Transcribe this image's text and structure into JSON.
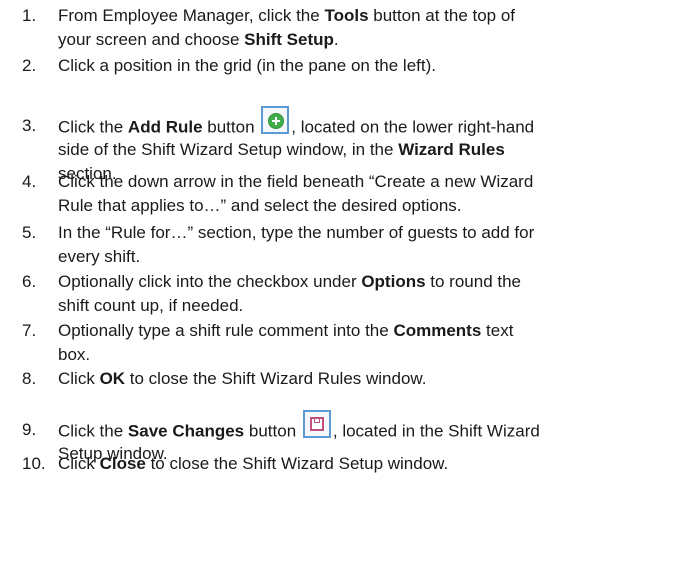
{
  "steps": [
    {
      "num": "1.",
      "lines": [
        [
          {
            "t": "From Employee Manager, click the "
          },
          {
            "t": "Tools",
            "b": true
          },
          {
            "t": " button at the top of"
          }
        ],
        [
          {
            "t": "your screen and choose "
          },
          {
            "t": "Shift Setup",
            "b": true
          },
          {
            "t": "."
          }
        ]
      ]
    },
    {
      "num": "2.",
      "lines": [
        [
          {
            "t": "Click a position in the grid (in the pane on the left)."
          }
        ]
      ]
    },
    {
      "num": "3.",
      "lines": [
        [
          {
            "t": "Click the "
          },
          {
            "t": "Add Rule",
            "b": true
          },
          {
            "t": " button "
          },
          {
            "icon": "add-icon"
          },
          {
            "t": ", located on the lower right-hand"
          }
        ],
        [
          {
            "t": "side of the Shift Wizard Setup window, in the "
          },
          {
            "t": "Wizard Rules",
            "b": true
          }
        ],
        [
          {
            "t": "section."
          }
        ]
      ]
    },
    {
      "num": "4.",
      "lines": [
        [
          {
            "t": "Click the down arrow in the field beneath “Create a new Wizard"
          }
        ],
        [
          {
            "t": "Rule that applies to…” and select the desired options."
          }
        ]
      ]
    },
    {
      "num": "5.",
      "lines": [
        [
          {
            "t": "In the “Rule for…” section, type the number of guests to add for"
          }
        ],
        [
          {
            "t": "every shift."
          }
        ]
      ]
    },
    {
      "num": "6.",
      "lines": [
        [
          {
            "t": "Optionally click into the checkbox under "
          },
          {
            "t": "Options",
            "b": true
          },
          {
            "t": " to round the"
          }
        ],
        [
          {
            "t": "shift count up, if needed."
          }
        ]
      ]
    },
    {
      "num": "7.",
      "lines": [
        [
          {
            "t": "Optionally type a shift rule comment into the "
          },
          {
            "t": "Comments",
            "b": true
          },
          {
            "t": " text"
          }
        ],
        [
          {
            "t": "box."
          }
        ]
      ]
    },
    {
      "num": "8.",
      "lines": [
        [
          {
            "t": "Click "
          },
          {
            "t": "OK",
            "b": true
          },
          {
            "t": " to close the Shift Wizard Rules window."
          }
        ]
      ]
    },
    {
      "num": "9.",
      "lines": [
        [
          {
            "t": "Click the "
          },
          {
            "t": "Save Changes",
            "b": true
          },
          {
            "t": " button "
          },
          {
            "icon": "save-icon"
          },
          {
            "t": ", located in the Shift Wizard"
          }
        ],
        [
          {
            "t": "Setup window."
          }
        ]
      ]
    },
    {
      "num": "10.",
      "lines": [
        [
          {
            "t": "Click "
          },
          {
            "t": "Close",
            "b": true
          },
          {
            "t": " to close the Shift Wizard Setup window."
          }
        ]
      ]
    }
  ]
}
